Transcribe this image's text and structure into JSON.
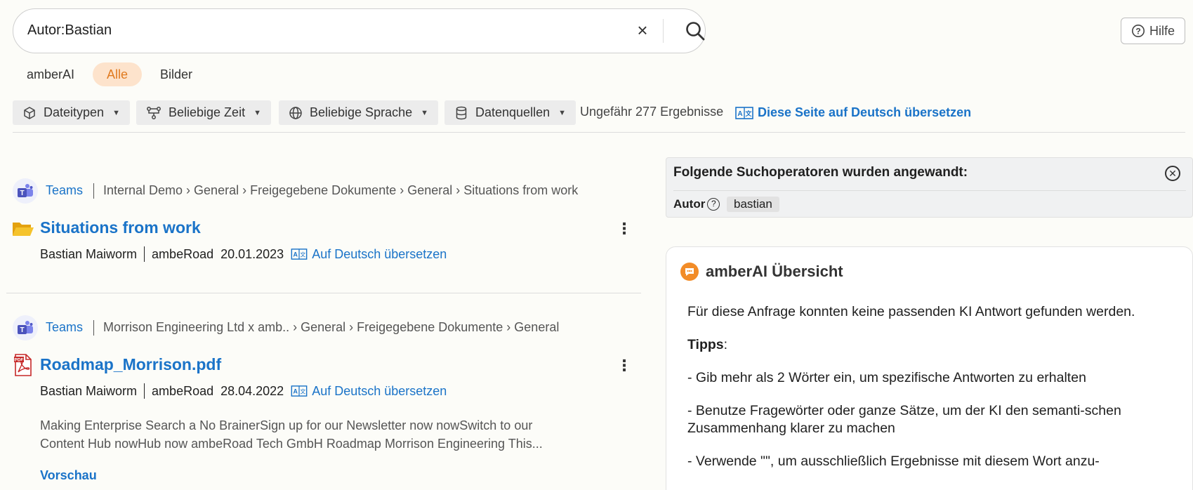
{
  "search": {
    "query": "Autor:Bastian",
    "clear_symbol": "×"
  },
  "help": {
    "label": "Hilfe"
  },
  "tabs": [
    {
      "label": "amberAI"
    },
    {
      "label": "Alle",
      "active": true
    },
    {
      "label": "Bilder"
    }
  ],
  "filters": [
    {
      "label": "Dateitypen",
      "icon": "cube-icon"
    },
    {
      "label": "Beliebige Zeit",
      "icon": "timeline-icon"
    },
    {
      "label": "Beliebige Sprache",
      "icon": "globe-icon"
    },
    {
      "label": "Datenquellen",
      "icon": "database-icon"
    }
  ],
  "result_count": "Ungefähr 277 Ergebnisse",
  "translate_page": "Diese Seite auf Deutsch übersetzen",
  "results": [
    {
      "source": "Teams",
      "breadcrumb": "Internal Demo › General › Freigegebene Dokumente › General › Situations from work",
      "title": "Situations from work",
      "type_icon": "folder-icon",
      "author": "Bastian Maiworm",
      "org": "ambeRoad",
      "date": "20.01.2023",
      "translate": "Auf Deutsch übersetzen"
    },
    {
      "source": "Teams",
      "breadcrumb": "Morrison Engineering Ltd x amb.. › General › Freigegebene Dokumente › General",
      "title": "Roadmap_Morrison.pdf",
      "type_icon": "pdf-icon",
      "author": "Bastian Maiworm",
      "org": "ambeRoad",
      "date": "28.04.2022",
      "translate": "Auf Deutsch übersetzen",
      "snippet_line1": "Making Enterprise Search a No BrainerSign up for our Newsletter now nowSwitch to our",
      "snippet_line2": "Content Hub nowHub now ambeRoad Tech GmbH Roadmap Morrison Engineering This...",
      "preview": "Vorschau"
    }
  ],
  "operators": {
    "title": "Folgende Suchoperatoren wurden angewandt:",
    "key": "Autor",
    "value": "bastian"
  },
  "ai": {
    "title": "amberAI Übersicht",
    "message": "Für diese Anfrage konnten keine passenden KI Antwort gefunden werden.",
    "tips_label": "Tipps",
    "tip1": "- Gib mehr als 2 Wörter ein, um spezifische Antworten zu erhalten",
    "tip2": "- Benutze Fragewörter oder ganze Sätze, um der KI den semanti-schen Zusammenhang klarer zu machen",
    "tip3": "- Verwende \"\", um ausschließlich Ergebnisse mit diesem Wort anzu-"
  },
  "colors": {
    "link": "#1a73c8",
    "accent": "#e07a1f",
    "active_tab_bg": "#fde3cc",
    "pdf_red": "#c62828",
    "folder_yellow": "#f5c32c"
  }
}
